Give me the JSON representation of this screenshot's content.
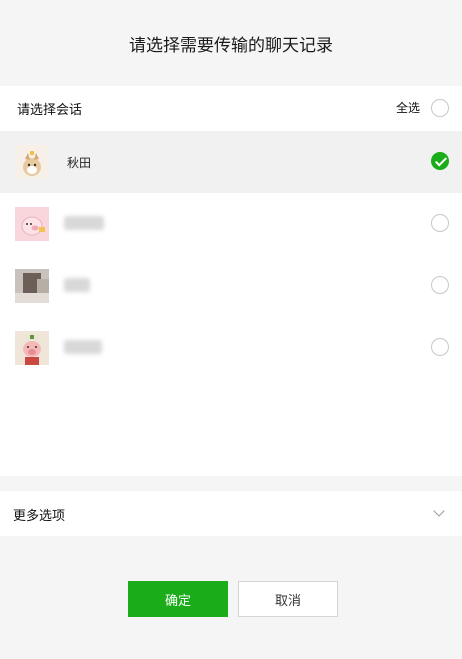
{
  "dialog": {
    "title": "请选择需要传输的聊天记录"
  },
  "conversations": {
    "header_label": "请选择会话",
    "select_all_label": "全选",
    "items": [
      {
        "name": "秋田",
        "selected": true,
        "avatar": "dog-avatar-icon"
      },
      {
        "name": "",
        "selected": false,
        "avatar": "pink-pig-avatar-icon"
      },
      {
        "name": "",
        "selected": false,
        "avatar": "photo-avatar-icon"
      },
      {
        "name": "",
        "selected": false,
        "avatar": "pig-avatar-icon"
      }
    ]
  },
  "more_options": {
    "label": "更多选项"
  },
  "buttons": {
    "confirm": "确定",
    "cancel": "取消"
  },
  "colors": {
    "accent": "#1aad19"
  }
}
